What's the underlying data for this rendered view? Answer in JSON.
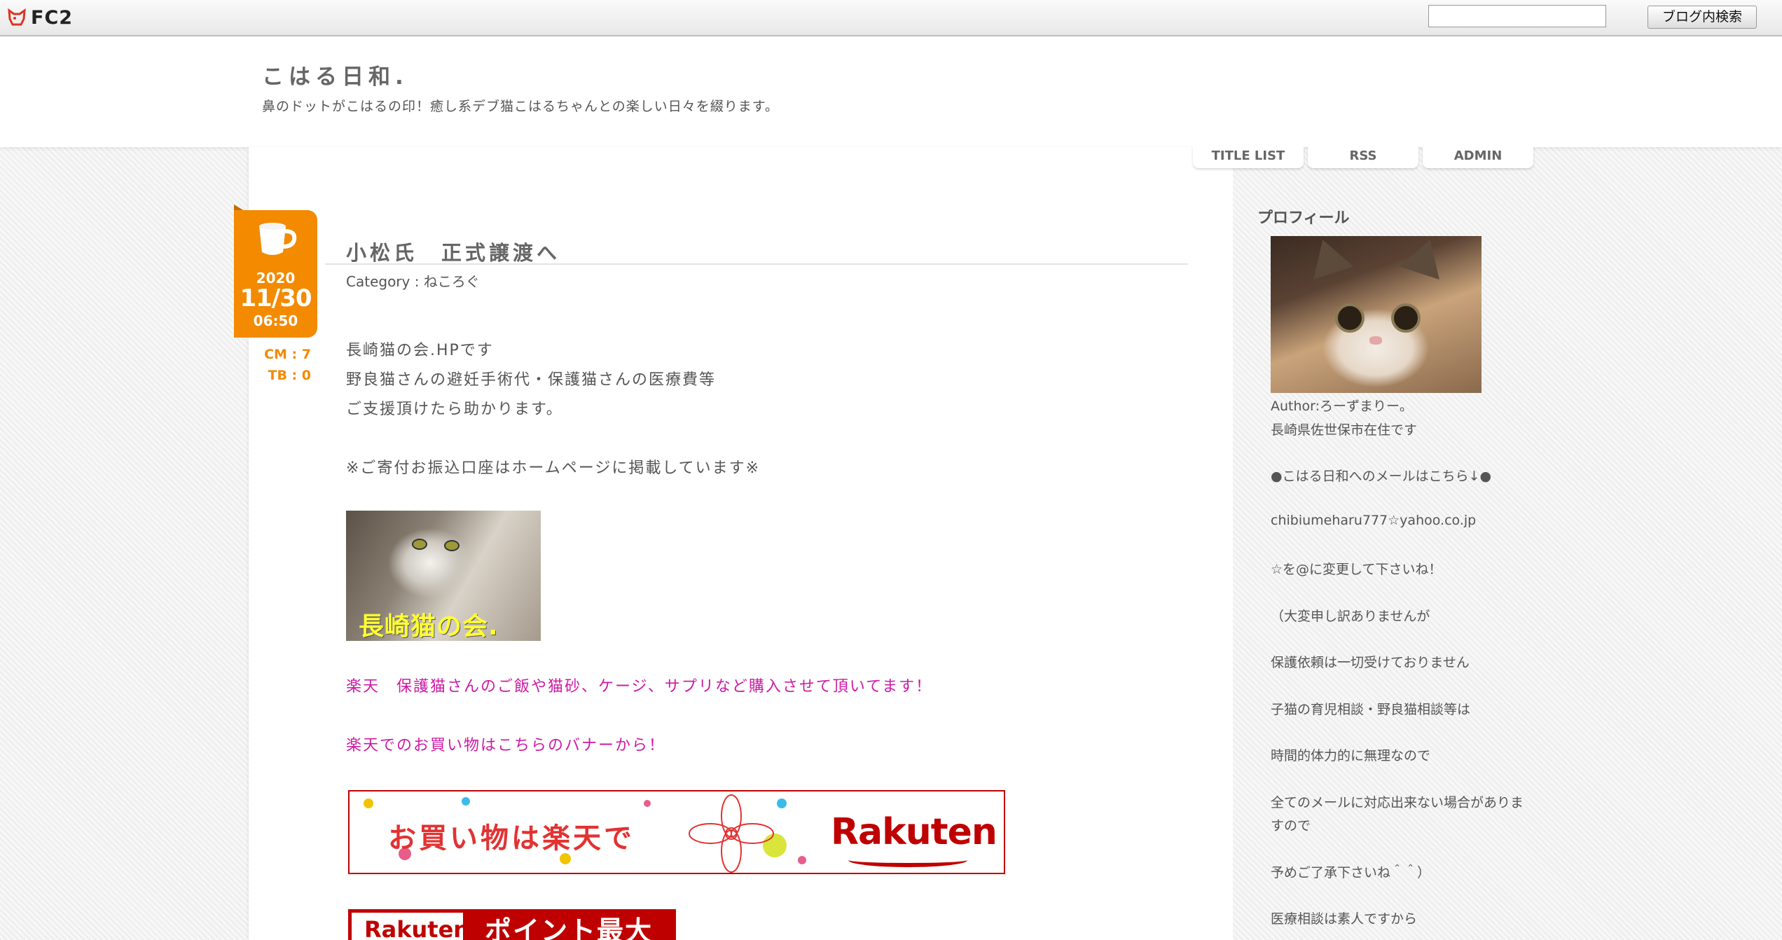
{
  "fc2bar": {
    "logo_text": "FC2",
    "search_placeholder": "",
    "search_button": "ブログ内検索"
  },
  "header": {
    "title": "こはる日和.",
    "description": "鼻のドットがこはるの印！癒し系デブ猫こはるちゃんとの楽しい日々を綴ります。"
  },
  "nav": {
    "items": [
      {
        "label": "TITLE LIST"
      },
      {
        "label": "RSS"
      },
      {
        "label": "ADMIN"
      }
    ]
  },
  "entry": {
    "date": {
      "year": "2020",
      "month_day": "11/30",
      "time": "06:50"
    },
    "comments": "CM : 7",
    "trackbacks": "TB : 0",
    "title": "小松氏　正式譲渡へ",
    "category": "Category : ねころぐ",
    "body": [
      "長崎猫の会.HPです",
      "野良猫さんの避妊手術代・保護猫さんの医療費等",
      "ご支援頂けたら助かります。",
      "※ご寄付お振込口座はホームページに掲載しています※"
    ],
    "image_watermark": "長崎猫の会.",
    "pink_lines": [
      "楽天　保護猫さんのご飯や猫砂、ケージ、サプリなど購入させて頂いてます！",
      "楽天でのお買い物はこちらのバナーから！"
    ],
    "banner1": {
      "text": "お買い物は楽天で",
      "logo": "Rakuten"
    },
    "banner2": {
      "logo": "Rakuten",
      "text": "ポイント最大"
    }
  },
  "sidebar": {
    "heading": "プロフィール",
    "lines": [
      "Author:ろーずまりー。",
      "長崎県佐世保市在住です",
      "●こはる日和へのメールはこちら↓●",
      "chibiumeharu777☆yahoo.co.jp",
      "☆を@に変更して下さいね！",
      "（大変申し訳ありませんが",
      "保護依頼は一切受けておりません",
      "子猫の育児相談・野良猫相談等は",
      "時間的体力的に無理なので",
      "全てのメールに対応出来ない場合がありま",
      "すので",
      "予めご了承下さいね＾＾）",
      "医療相談は素人ですから"
    ]
  },
  "colors": {
    "accent_orange": "#f38a00",
    "pink_text": "#cc1aa5",
    "rakuten_red": "#bf0000"
  }
}
